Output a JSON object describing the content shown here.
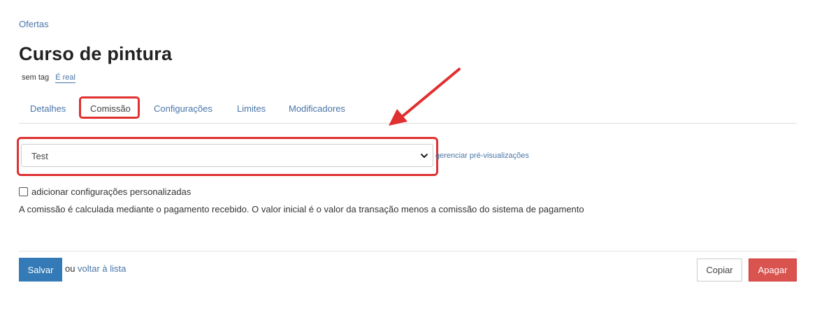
{
  "breadcrumb": {
    "label": "Ofertas"
  },
  "page": {
    "title": "Curso de pintura",
    "tag_label": "sem tag",
    "real_label": "É real"
  },
  "tabs": [
    {
      "label": "Detalhes",
      "active": false
    },
    {
      "label": "Comissão",
      "active": true
    },
    {
      "label": "Configurações",
      "active": false
    },
    {
      "label": "Limites",
      "active": false
    },
    {
      "label": "Modificadores",
      "active": false
    }
  ],
  "commission": {
    "selected": "Test",
    "manage_link": "gerenciar pré-visualizações",
    "custom_settings_label": "adicionar configurações personalizadas",
    "custom_settings_checked": false,
    "info": "A comissão é calculada mediante o pagamento recebido. O valor inicial é o valor da transação menos a comissão do sistema de pagamento"
  },
  "footer": {
    "save_label": "Salvar",
    "or_text": "ou",
    "back_link": "voltar à lista",
    "copy_label": "Copiar",
    "delete_label": "Apagar"
  },
  "colors": {
    "link": "#4a76a8",
    "primary": "#337ab7",
    "danger": "#d9534f",
    "annotation": "#e03030"
  },
  "icons": {
    "select_toggle": "chevron-down-icon",
    "annotation_arrow": "red-arrow-icon"
  }
}
